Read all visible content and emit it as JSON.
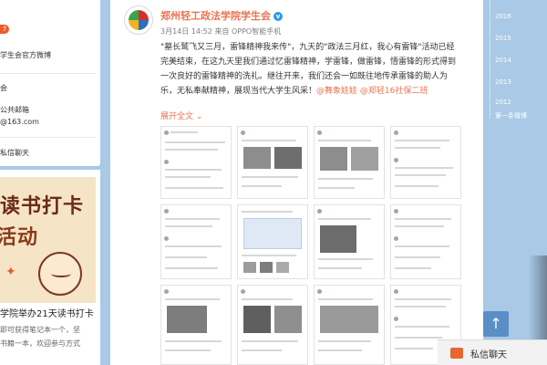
{
  "left": {
    "badge": "7",
    "line1": "学生会官方微博",
    "line2": "会",
    "line3": "公共邮箱",
    "line4": "@163.com",
    "line5": "私信聊天",
    "poster_text_1": "读书打卡",
    "poster_text_2": "活动",
    "promo_title": "学院举办21天读书打卡",
    "promo_text_1": "即可获得笔记本一个，坚",
    "promo_text_2": "书籍一本，欢迎参与方式"
  },
  "post": {
    "name": "郑州轻工政法学院学生会",
    "verified_icon": "v",
    "meta": "3月14日 14:52 来自 OPPO智能手机",
    "body_1": "\"墓长鹫飞又三月，雷锋精神我来传\"，九天的\"政法三月红，我心有雷锋\"活动已经",
    "body_2": "完美结束，在这九天里我们通过忆雷锋精神，学雷锋，做雷锋，悟雷锋的形式得到",
    "body_3": "一次良好的雷锋精神的洗礼。继往开来，我们还会一如既往地传承雷锋的助人为",
    "body_4": "乐，无私奉献精神，展现当代大学生风采！",
    "mention_1": "@舞象娃娃",
    "mention_2": "@郑轻16社保二班",
    "expand": "展开全文 ⌄"
  },
  "timeline": {
    "years": [
      "2016",
      "2015",
      "2014",
      "2013",
      "2012"
    ],
    "link": "第一条微博"
  },
  "chat": {
    "label": "私信聊天",
    "back_top": "↑"
  }
}
